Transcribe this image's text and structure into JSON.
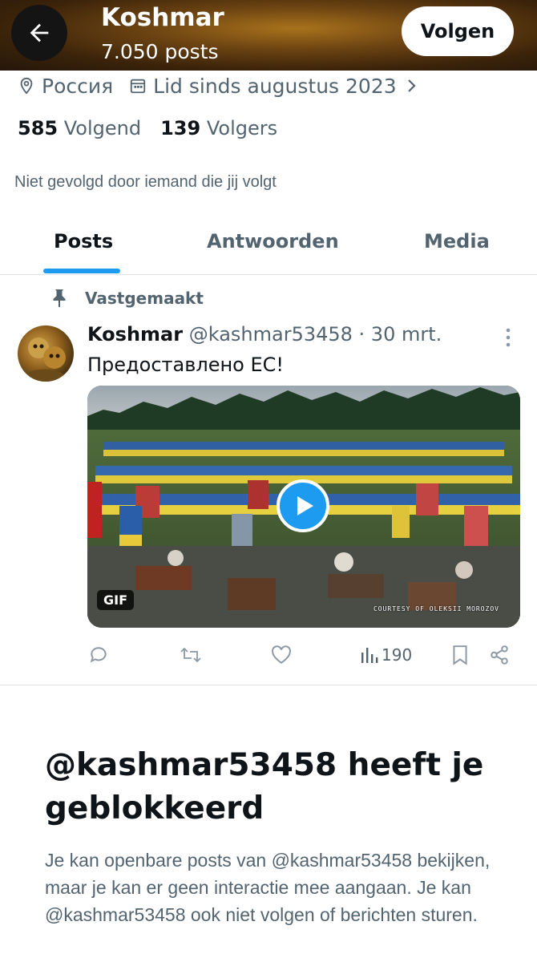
{
  "header": {
    "name": "Koshmar",
    "posts_count": "7.050 posts",
    "follow_label": "Volgen"
  },
  "profile": {
    "location": "Россия",
    "joined": "Lid sinds augustus 2023",
    "following_count": "585",
    "following_label": "Volgend",
    "followers_count": "139",
    "followers_label": "Volgers",
    "not_followed_text": "Niet gevolgd door iemand die jij volgt"
  },
  "tabs": [
    {
      "label": "Posts",
      "active": true
    },
    {
      "label": "Antwoorden",
      "active": false
    },
    {
      "label": "Media",
      "active": false
    }
  ],
  "pinned_post": {
    "pinned_label": "Vastgemaakt",
    "author_name": "Koshmar",
    "handle_date": "@kashmar53458 · 30 mrt.",
    "text": "Предоставлено ЕС!",
    "media_badge": "GIF",
    "media_watermark": "COURTESY OF OLEKSII MOROZOV",
    "views": "190"
  },
  "blocked": {
    "title": "@kashmar53458 heeft je geblokkeerd",
    "text": "Je kan openbare posts van @kashmar53458 bekijken, maar je kan er geen interactie mee aangaan. Je kan @kashmar53458 ook niet volgen of berichten sturen."
  },
  "colors": {
    "accent": "#1d9bf0",
    "text_primary": "#0f1419",
    "text_secondary": "#536471"
  }
}
